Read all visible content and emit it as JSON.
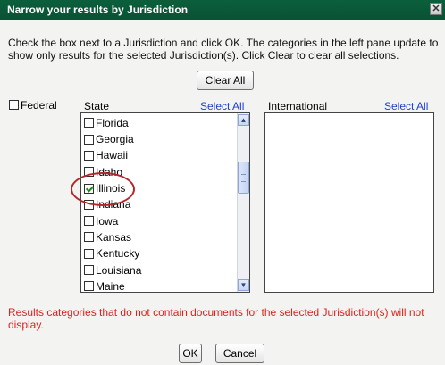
{
  "dialog": {
    "title": "Narrow your results by Jurisdiction",
    "close_glyph": "✕",
    "instructions": "Check the box next to a Jurisdiction and click OK. The categories in the left pane update to show only results for the selected Jurisdiction(s). Click Clear to clear all selections.",
    "clear_all_label": "Clear All",
    "federal_label": "Federal",
    "state_header": "State",
    "state_select_all": "Select All",
    "international_header": "International",
    "international_select_all": "Select All",
    "states": [
      {
        "name": "Florida",
        "checked": false
      },
      {
        "name": "Georgia",
        "checked": false
      },
      {
        "name": "Hawaii",
        "checked": false
      },
      {
        "name": "Idaho",
        "checked": false
      },
      {
        "name": "Illinois",
        "checked": true
      },
      {
        "name": "Indiana",
        "checked": false
      },
      {
        "name": "Iowa",
        "checked": false
      },
      {
        "name": "Kansas",
        "checked": false
      },
      {
        "name": "Kentucky",
        "checked": false
      },
      {
        "name": "Louisiana",
        "checked": false
      },
      {
        "name": "Maine",
        "checked": false
      }
    ],
    "note": "Results categories that do not contain documents for the selected Jurisdiction(s) will not display.",
    "ok_label": "OK",
    "cancel_label": "Cancel"
  },
  "colors": {
    "titlebar": "#0b5f3c",
    "link": "#1f3fd0",
    "note_text": "#e0201b",
    "highlight_ring": "#b3262b"
  }
}
